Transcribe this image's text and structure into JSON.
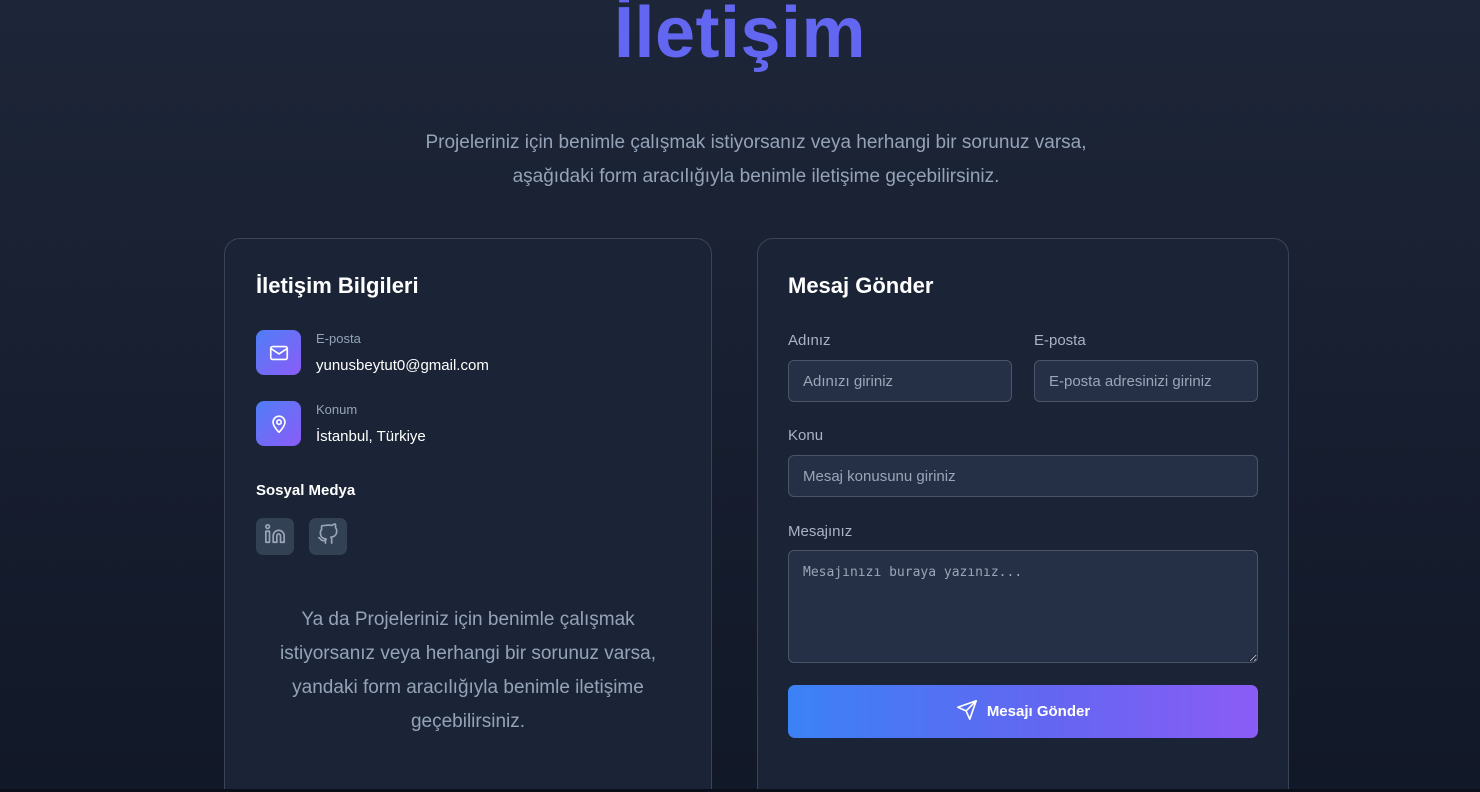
{
  "page": {
    "title": "İletişim",
    "subtitle": "Projeleriniz için benimle çalışmak istiyorsanız veya herhangi bir sorunuz varsa, aşağıdaki form aracılığıyla benimle iletişime geçebilirsiniz."
  },
  "contact_info": {
    "heading": "İletişim Bilgileri",
    "items": [
      {
        "icon": "mail-icon",
        "label": "E-posta",
        "value": "yunusbeytut0@gmail.com"
      },
      {
        "icon": "map-pin-icon",
        "label": "Konum",
        "value": "İstanbul, Türkiye"
      }
    ],
    "social_heading": "Sosyal Medya",
    "social": [
      {
        "icon": "linkedin-icon"
      },
      {
        "icon": "github-icon"
      }
    ],
    "note": "Ya da Projeleriniz için benimle çalışmak istiyorsanız veya herhangi bir sorunuz varsa, yandaki form aracılığıyla benimle iletişime geçebilirsiniz."
  },
  "form": {
    "heading": "Mesaj Gönder",
    "name": {
      "label": "Adınız",
      "placeholder": "Adınızı giriniz",
      "value": ""
    },
    "email": {
      "label": "E-posta",
      "placeholder": "E-posta adresinizi giriniz",
      "value": ""
    },
    "subject": {
      "label": "Konu",
      "placeholder": "Mesaj konusunu giriniz",
      "value": ""
    },
    "message": {
      "label": "Mesajınız",
      "placeholder": "Mesajınızı buraya yazınız...",
      "value": ""
    },
    "submit_label": "Mesajı Gönder",
    "submit_icon": "send-icon"
  },
  "colors": {
    "accent": "#6366f1",
    "gradient_start": "#3b82f6",
    "gradient_end": "#8b5cf6",
    "background": "#1b2436"
  }
}
